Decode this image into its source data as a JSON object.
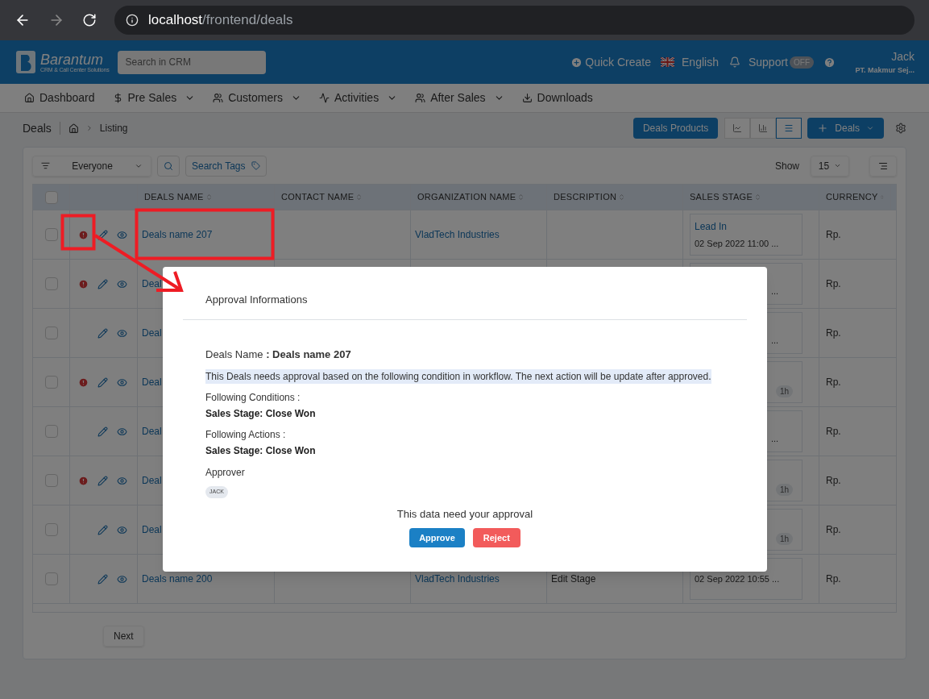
{
  "browser": {
    "url_host": "localhost",
    "url_path": "/frontend/deals"
  },
  "header": {
    "logo_name": "Barantum",
    "logo_tagline": "CRM & Call Center Solutions",
    "search_placeholder": "Search in CRM",
    "quick_create": "Quick Create",
    "language": "English",
    "support": "Support",
    "support_toggle": {
      "label": "OFF",
      "on": false
    },
    "user_name": "Jack",
    "company": "PT. Makmur Sej..."
  },
  "nav": [
    {
      "label": "Dashboard",
      "dropdown": false
    },
    {
      "label": "Pre Sales",
      "dropdown": true
    },
    {
      "label": "Customers",
      "dropdown": true
    },
    {
      "label": "Activities",
      "dropdown": true
    },
    {
      "label": "After Sales",
      "dropdown": true
    },
    {
      "label": "Downloads",
      "dropdown": false
    }
  ],
  "breadcrumb": {
    "section": "Deals",
    "page": "Listing"
  },
  "toolbar": {
    "products_button": "Deals Products",
    "views": [
      {
        "selected": false
      },
      {
        "selected": false
      },
      {
        "selected": true
      }
    ],
    "add_button": "Deals"
  },
  "filters": {
    "owner": "Everyone",
    "tags_button": "Search Tags",
    "show_label": "Show",
    "page_size": "15"
  },
  "table": {
    "select_all_checked": false,
    "columns": [
      "DEALS NAME",
      "CONTACT NAME",
      "ORGANIZATION NAME",
      "DESCRIPTION",
      "SALES STAGE",
      "CURRENCY"
    ],
    "rows": [
      {
        "checked": false,
        "pending": true,
        "name": "Deals name 207",
        "organization": "VladTech Industries",
        "stage": "Lead In",
        "stage_time": "02 Sep 2022 11:00 ...",
        "currency": "Rp."
      },
      {
        "checked": false,
        "pending": true,
        "name": "Deal",
        "stage_tail": "...",
        "currency": "Rp."
      },
      {
        "checked": false,
        "pending": false,
        "name": "Deal",
        "stage_tail": "...",
        "currency": "Rp."
      },
      {
        "checked": false,
        "pending": true,
        "name": "Deal",
        "badge": "1h",
        "currency": "Rp."
      },
      {
        "checked": false,
        "pending": false,
        "name": "Deal",
        "stage_tail": "...",
        "currency": "Rp."
      },
      {
        "checked": false,
        "pending": true,
        "name": "Deal",
        "badge": "1h",
        "currency": "Rp."
      },
      {
        "checked": false,
        "pending": false,
        "name": "Deal",
        "badge": "1h",
        "currency": "Rp."
      },
      {
        "checked": false,
        "pending": false,
        "name": "Deals name 200",
        "organization": "VladTech Industries",
        "description": "Edit Stage",
        "stage_time": "02 Sep 2022 10:55 ...",
        "currency": "Rp."
      }
    ]
  },
  "pagination": {
    "next": "Next"
  },
  "modal": {
    "title": "Approval Informations",
    "deal_line": "Deals Name **: Deals name 207**",
    "notice": "This Deals needs approval based on the following condition in workflow. The next action will be update after approved.",
    "conditions_label": "Following Conditions :",
    "conditions": "Sales Stage: Close Won",
    "actions_label": "Following Actions :",
    "actions": "Sales Stage: Close Won",
    "approver_label": "Approver",
    "approver": "JACK",
    "prompt": "This data need your approval",
    "approve": "Approve",
    "reject": "Reject"
  }
}
